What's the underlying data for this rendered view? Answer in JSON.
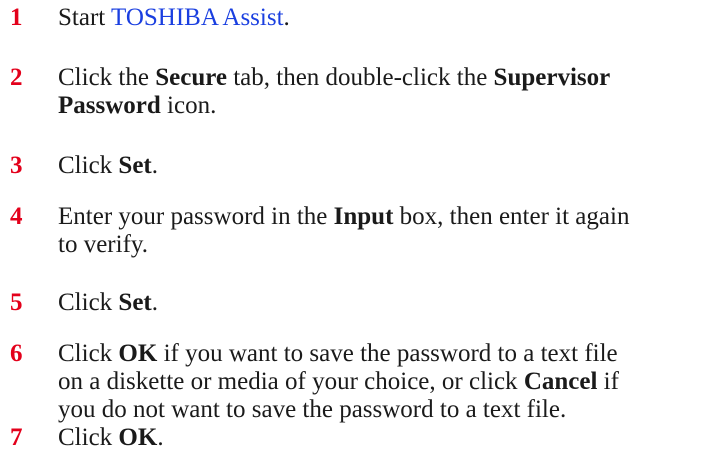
{
  "steps": [
    {
      "number": "1",
      "text_before": "Start ",
      "link": "TOSHIBA Assist",
      "text_after": "."
    },
    {
      "number": "2",
      "line1_a": "Click the ",
      "line1_b": "Secure",
      "line1_c": " tab, then double-click the ",
      "line1_d": "Supervisor",
      "line2_a": "Password",
      "line2_b": " icon."
    },
    {
      "number": "3",
      "a": "Click ",
      "b": "Set",
      "c": "."
    },
    {
      "number": "4",
      "line1_a": "Enter your password in the ",
      "line1_b": "Input",
      "line1_c": " box, then enter it again",
      "line2": "to verify."
    },
    {
      "number": "5",
      "a": "Click ",
      "b": "Set",
      "c": "."
    },
    {
      "number": "6",
      "line1_a": "Click ",
      "line1_b": "OK",
      "line1_c": " if you want to save the password to a text file",
      "line2_a": "on a diskette or media of your choice, or click ",
      "line2_b": "Cancel",
      "line2_c": " if",
      "line3": "you do not want to save the password to a text file."
    },
    {
      "number": "7",
      "a": "Click ",
      "b": "OK",
      "c": "."
    }
  ],
  "colors": {
    "step_number": "#e3001b",
    "link": "#1a3fe0",
    "text": "#1a1a1a"
  }
}
